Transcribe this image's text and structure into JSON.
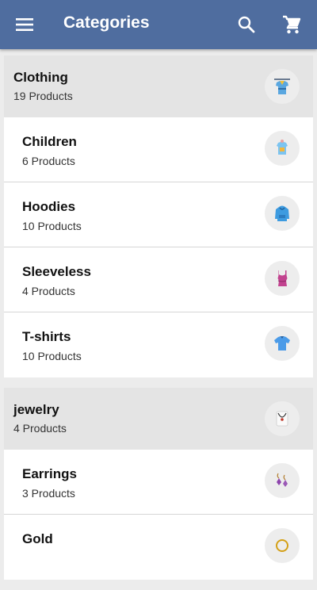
{
  "appbar": {
    "title": "Categories",
    "menu_icon": "menu-icon",
    "search_icon": "search-icon",
    "cart_icon": "cart-icon",
    "bg_color": "#4f6d9f"
  },
  "groups": [
    {
      "name": "Clothing",
      "count": "19 Products",
      "icon": "clothing-icon",
      "items": [
        {
          "name": "Children",
          "count": "6 Products",
          "icon": "children-shirt-icon"
        },
        {
          "name": "Hoodies",
          "count": "10 Products",
          "icon": "hoodie-icon"
        },
        {
          "name": "Sleeveless",
          "count": "4 Products",
          "icon": "tank-top-icon"
        },
        {
          "name": "T-shirts",
          "count": "10 Products",
          "icon": "tshirt-icon"
        }
      ]
    },
    {
      "name": "jewelry",
      "count": "4 Products",
      "icon": "necklace-icon",
      "items": [
        {
          "name": "Earrings",
          "count": "3 Products",
          "icon": "earrings-icon"
        },
        {
          "name": "Gold",
          "count": "",
          "icon": "gold-icon"
        }
      ]
    }
  ]
}
